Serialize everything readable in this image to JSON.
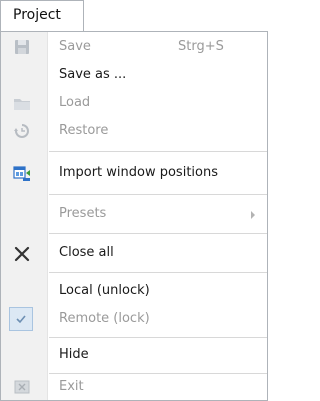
{
  "tab": {
    "label": "Project"
  },
  "menu": {
    "save": {
      "label": "Save",
      "shortcut": "Strg+S"
    },
    "save_as": {
      "label": "Save as ..."
    },
    "load": {
      "label": "Load"
    },
    "restore": {
      "label": "Restore"
    },
    "import_window_positions": {
      "label": "Import window positions"
    },
    "presets": {
      "label": "Presets"
    },
    "close_all": {
      "label": "Close all"
    },
    "local_unlock": {
      "label": "Local (unlock)"
    },
    "remote_lock": {
      "label": "Remote (lock)",
      "checked": true
    },
    "hide": {
      "label": "Hide"
    },
    "exit": {
      "label": "Exit"
    }
  },
  "icons": {
    "save": "floppy-disk-icon",
    "load": "folder-icon",
    "restore": "restore-icon",
    "import": "import-window-icon",
    "close_all": "close-x-icon",
    "remote_lock": "checkmark-icon",
    "exit": "exit-icon"
  },
  "colors": {
    "disabled_text": "#9a9a9a",
    "gutter": "#f1f1f1",
    "checkbox_bg": "#dce8f4",
    "import_icon_blue": "#2e72c8"
  }
}
